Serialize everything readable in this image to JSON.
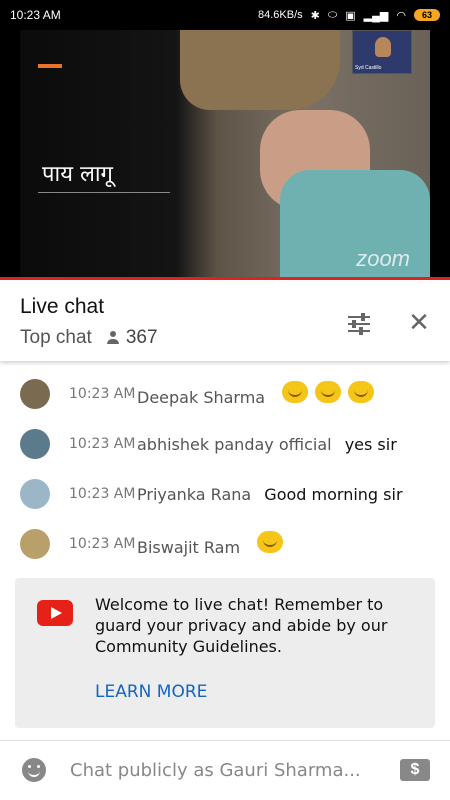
{
  "status_bar": {
    "time": "10:23 AM",
    "speed": "84.6KB/s",
    "battery": "63"
  },
  "video": {
    "slide_title": "पाय लागू",
    "pip_name": "Syd Castillo",
    "watermark": "zoom"
  },
  "chat_header": {
    "title": "Live chat",
    "mode": "Top chat",
    "viewers": "367"
  },
  "messages": [
    {
      "time": "10:23 AM",
      "author": "Deepak Sharma",
      "text": "",
      "emoji_count": 3,
      "avatar_color": "#7a6a4f"
    },
    {
      "time": "10:23 AM",
      "author": "abhishek panday official",
      "text": "yes sir",
      "emoji_count": 0,
      "avatar_color": "#5b7a8c"
    },
    {
      "time": "10:23 AM",
      "author": "Priyanka Rana",
      "text": "Good morning sir",
      "emoji_count": 0,
      "avatar_color": "#9bb6c6"
    },
    {
      "time": "10:23 AM",
      "author": "Biswajit Ram",
      "text": "",
      "emoji_count": 1,
      "avatar_color": "#b9a06a"
    }
  ],
  "welcome": {
    "text": "Welcome to live chat! Remember to guard your privacy and abide by our Community Guidelines.",
    "learn_more": "LEARN MORE"
  },
  "input": {
    "placeholder": "Chat publicly as Gauri Sharma..."
  }
}
